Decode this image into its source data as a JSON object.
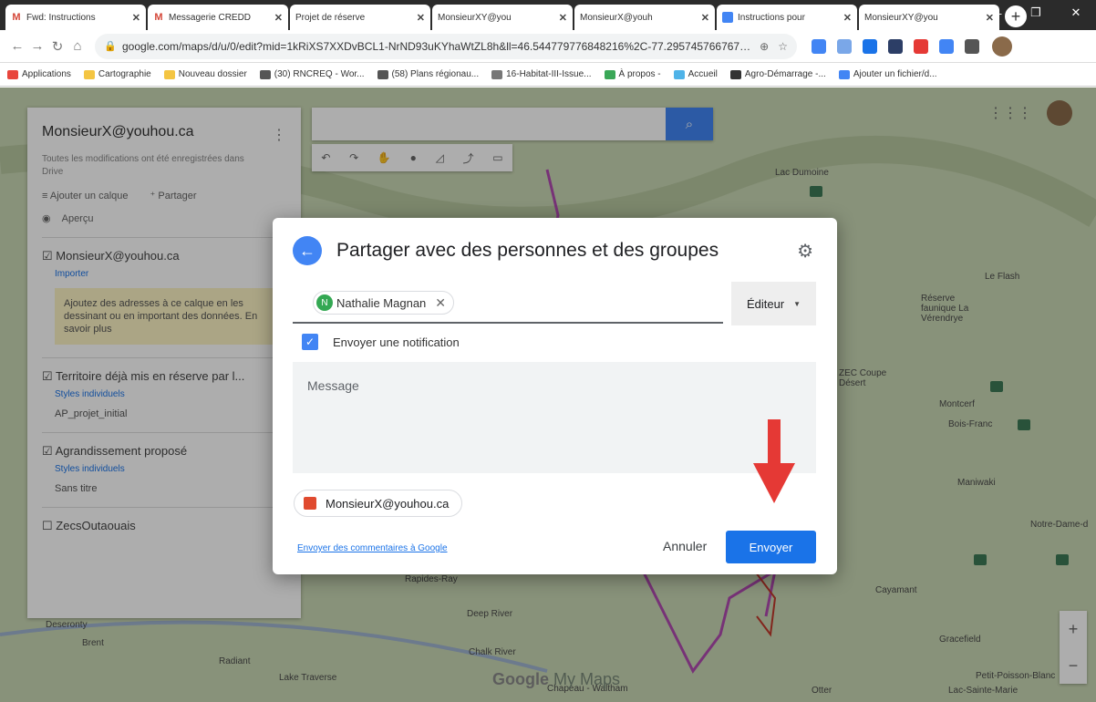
{
  "browser": {
    "tabs": [
      {
        "label": "Fwd: Instructions",
        "icon": "gmail-icon"
      },
      {
        "label": "Messagerie CREDD",
        "icon": "gmail-icon"
      },
      {
        "label": "Projet de réserve",
        "icon": "mymaps-icon"
      },
      {
        "label": "MonsieurXY@you",
        "icon": "mymaps-icon"
      },
      {
        "label": "MonsieurX@youh",
        "icon": "mymaps-icon"
      },
      {
        "label": "Instructions pour",
        "icon": "docs-icon"
      },
      {
        "label": "MonsieurXY@you",
        "icon": "mymaps-icon"
      }
    ],
    "url": "google.com/maps/d/u/0/edit?mid=1kRiXS7XXDvBCL1-NrND93uKYhaWtZL8h&ll=46.544779776848216%2C-77.29574576676754&z...",
    "bookmarks": [
      {
        "label": "Applications",
        "color": "#e8453c"
      },
      {
        "label": "Cartographie",
        "color": "#f4c542"
      },
      {
        "label": "Nouveau dossier",
        "color": "#f4c542"
      },
      {
        "label": "(30) RNCREQ - Wor...",
        "color": "#555555"
      },
      {
        "label": "(58) Plans régionau...",
        "color": "#555555"
      },
      {
        "label": "16-Habitat-III-Issue...",
        "color": "#777777"
      },
      {
        "label": "À propos -",
        "color": "#3aa757"
      },
      {
        "label": "Accueil",
        "color": "#4fb3e8"
      },
      {
        "label": "Agro-Démarrage -...",
        "color": "#333333"
      },
      {
        "label": "Ajouter un fichier/d...",
        "color": "#4285f4"
      }
    ]
  },
  "panel": {
    "title": "MonsieurX@youhou.ca",
    "saved": "Toutes les modifications ont été enregistrées dans Drive",
    "add_layer": "Ajouter un calque",
    "share": "Partager",
    "preview": "Aperçu",
    "layer1": {
      "name": "MonsieurX@youhou.ca",
      "import": "Importer",
      "note": "Ajoutez des adresses à ce calque en les dessinant ou en important des données. En savoir plus"
    },
    "layer2": {
      "name": "Territoire déjà mis en réserve par l...",
      "styles": "Styles individuels",
      "item": "AP_projet_initial"
    },
    "layer3": {
      "name": "Agrandissement proposé",
      "styles": "Styles individuels",
      "item": "Sans titre"
    },
    "layer4": {
      "name": "ZecsOutaouais"
    }
  },
  "map_labels": [
    {
      "text": "Lac Dumoine"
    },
    {
      "text": "Le Flash"
    },
    {
      "text": "Réserve faunique La Vérendrye"
    },
    {
      "text": "ZEC Coupe Désert"
    },
    {
      "text": "Montcerf"
    },
    {
      "text": "Bois-Franc"
    },
    {
      "text": "Maniwaki"
    },
    {
      "text": "Notre-Dame-d"
    },
    {
      "text": "Cayamant"
    },
    {
      "text": "Gracefield"
    },
    {
      "text": "Petit-Poisson-Blanc"
    },
    {
      "text": "Lac-Sainte-Marie"
    },
    {
      "text": "Deep River"
    },
    {
      "text": "Chalk River"
    },
    {
      "text": "Lake Traverse"
    },
    {
      "text": "Radiant"
    },
    {
      "text": "Brent"
    },
    {
      "text": "Deseronty"
    },
    {
      "text": "Chapeau - Waltham"
    },
    {
      "text": "Otter"
    },
    {
      "text": "Rapides-Ray"
    }
  ],
  "map_watermark": {
    "brand": "Google",
    "product": "My Maps"
  },
  "dialog": {
    "title": "Partager avec des personnes et des groupes",
    "recipient": {
      "initial": "N",
      "name": "Nathalie Magnan"
    },
    "role": "Éditeur",
    "notify_label": "Envoyer une notification",
    "notify_checked": true,
    "message_placeholder": "Message",
    "owner": "MonsieurX@youhou.ca",
    "feedback_link": "Envoyer des commentaires à Google",
    "cancel_label": "Annuler",
    "send_label": "Envoyer"
  },
  "colors": {
    "accent": "#1a73e8",
    "annotation_arrow": "#e53935"
  }
}
